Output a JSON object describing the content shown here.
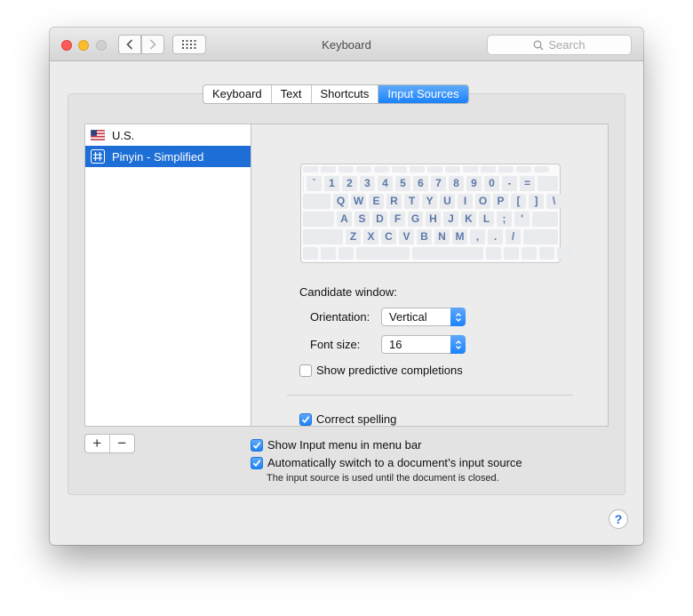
{
  "window": {
    "title": "Keyboard"
  },
  "toolbar": {
    "search_placeholder": "Search"
  },
  "tabs": [
    {
      "label": "Keyboard",
      "active": false
    },
    {
      "label": "Text",
      "active": false
    },
    {
      "label": "Shortcuts",
      "active": false
    },
    {
      "label": "Input Sources",
      "active": true
    }
  ],
  "sources": [
    {
      "label": "U.S.",
      "icon": "us-flag-icon",
      "selected": false
    },
    {
      "label": "Pinyin - Simplified",
      "icon": "pinyin-icon",
      "selected": true
    }
  ],
  "keyboard": {
    "rows": [
      [
        "`",
        "1",
        "2",
        "3",
        "4",
        "5",
        "6",
        "7",
        "8",
        "9",
        "0",
        "-",
        "="
      ],
      [
        "Q",
        "W",
        "E",
        "R",
        "T",
        "Y",
        "U",
        "I",
        "O",
        "P",
        "[",
        "]",
        "\\"
      ],
      [
        "A",
        "S",
        "D",
        "F",
        "G",
        "H",
        "J",
        "K",
        "L",
        ";",
        "'"
      ],
      [
        "Z",
        "X",
        "C",
        "V",
        "B",
        "N",
        "M",
        ",",
        ".",
        "/"
      ]
    ]
  },
  "candidate": {
    "heading": "Candidate window:",
    "orientation_label": "Orientation:",
    "orientation_value": "Vertical",
    "font_size_label": "Font size:",
    "font_size_value": "16",
    "predictive_label": "Show predictive completions",
    "predictive_checked": false,
    "correct_spelling_label": "Correct spelling",
    "correct_spelling_checked": true
  },
  "list_buttons": {
    "add": "+",
    "remove": "−"
  },
  "options": {
    "show_input_menu_label": "Show Input menu in menu bar",
    "show_input_menu_checked": true,
    "auto_switch_label": "Automatically switch to a document’s input source",
    "auto_switch_checked": true,
    "note": "The input source is used until the document is closed."
  },
  "help": "?",
  "colors": {
    "accent": "#1d6ed6",
    "tab_active": "#1a82fb",
    "key_text": "#5e79a8"
  }
}
